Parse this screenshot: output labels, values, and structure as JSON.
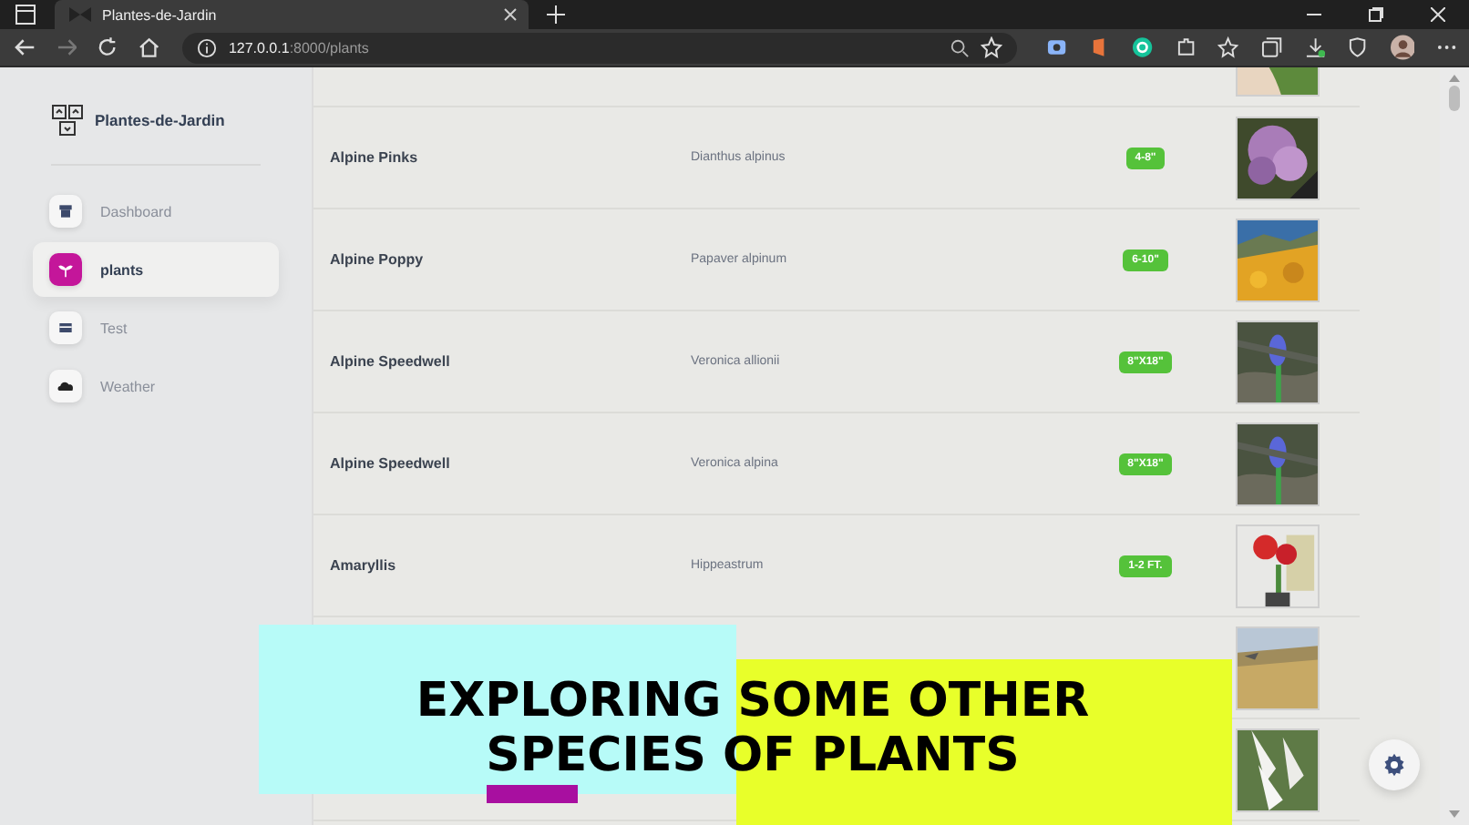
{
  "browser": {
    "tab_title": "Plantes-de-Jardin",
    "url_host": "127.0.0.1",
    "url_path": ":8000/plants"
  },
  "sidebar": {
    "brand": "Plantes-de-Jardin",
    "items": [
      {
        "label": "Dashboard",
        "selected": false
      },
      {
        "label": "plants",
        "selected": true
      },
      {
        "label": "Test",
        "selected": false
      },
      {
        "label": "Weather",
        "selected": false
      }
    ]
  },
  "table": {
    "rows": [
      {
        "kind": "partial"
      },
      {
        "kind": "full",
        "name": "Alpine Pinks",
        "species": "Dianthus alpinus",
        "size": "4-8\""
      },
      {
        "kind": "full",
        "name": "Alpine Poppy",
        "species": "Papaver alpinum",
        "size": "6-10\""
      },
      {
        "kind": "full",
        "name": "Alpine Speedwell",
        "species": "Veronica allionii",
        "size": "8\"X18\""
      },
      {
        "kind": "full",
        "name": "Alpine Speedwell",
        "species": "Veronica alpina",
        "size": "8\"X18\""
      },
      {
        "kind": "full",
        "name": "Amaryllis",
        "species": "Hippeastrum",
        "size": "1-2 FT."
      },
      {
        "kind": "covered"
      },
      {
        "kind": "covered"
      }
    ]
  },
  "caption": {
    "lines": [
      "EXPLORING SOME OTHER",
      "SPECIES OF PLANTS"
    ]
  }
}
